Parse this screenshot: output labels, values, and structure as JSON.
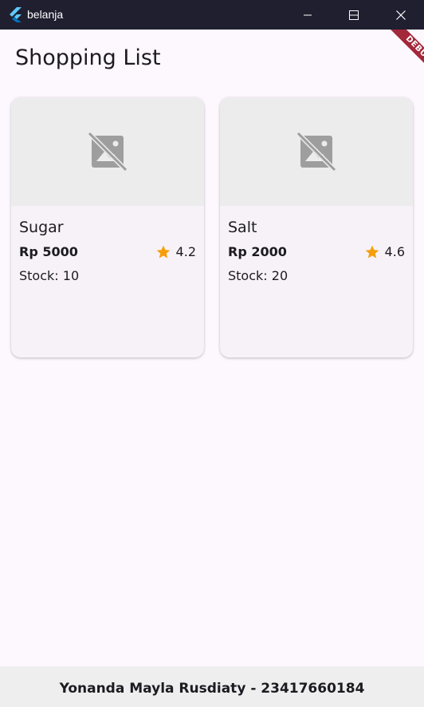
{
  "window": {
    "title": "belanja",
    "app_icon": "flutter-icon",
    "controls": [
      "minimize-icon",
      "maximize-icon",
      "close-icon"
    ]
  },
  "debug_banner": {
    "label": "DEBUG",
    "color": "#a3283a"
  },
  "appbar": {
    "title": "Shopping List"
  },
  "products": [
    {
      "name": "Sugar",
      "price": "Rp 5000",
      "rating": "4.2",
      "stock": "Stock: 10",
      "image_icon": "image-not-supported-icon"
    },
    {
      "name": "Salt",
      "price": "Rp 2000",
      "rating": "4.6",
      "stock": "Stock: 20",
      "image_icon": "image-not-supported-icon"
    }
  ],
  "footer": {
    "text": "Yonanda Mayla Rusdiaty - 23417660184"
  },
  "colors": {
    "titlebar": "#1f1f30",
    "background": "#fdf7fe",
    "card": "#f7f2f8",
    "star": "#f59e0b",
    "footer": "#eeeeee"
  }
}
